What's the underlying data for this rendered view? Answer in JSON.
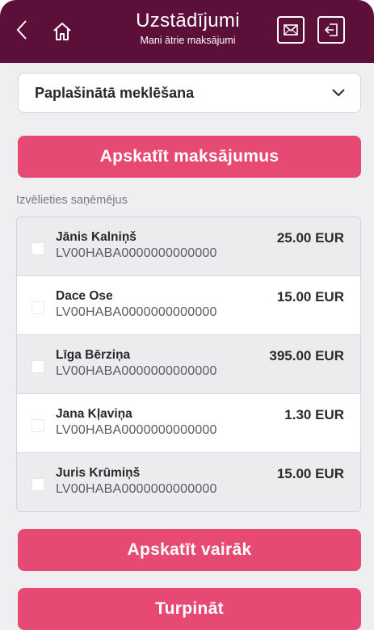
{
  "header": {
    "title": "Uzstādījumi",
    "subtitle": "Mani ātrie maksājumi",
    "back_icon": "chevron-left-icon",
    "home_icon": "home-icon",
    "mail_icon": "envelope-icon",
    "exit_icon": "logout-icon"
  },
  "search": {
    "dropdown_label": "Paplašinātā meklēšana"
  },
  "actions": {
    "view_payments_label": "Apskatīt maksājumus",
    "view_more_label": "Apskatīt vairāk",
    "continue_label": "Turpināt"
  },
  "recipients": {
    "section_label": "Izvēlieties saņēmējus",
    "items": [
      {
        "name": "Jānis Kalniņš",
        "iban": "LV00HABA0000000000000",
        "amount": "25.00 EUR"
      },
      {
        "name": "Dace Ose",
        "iban": "LV00HABA0000000000000",
        "amount": "15.00 EUR"
      },
      {
        "name": "Līga Bērziņa",
        "iban": "LV00HABA0000000000000",
        "amount": "395.00 EUR"
      },
      {
        "name": "Jana Kļaviņa",
        "iban": "LV00HABA0000000000000",
        "amount": "1.30 EUR"
      },
      {
        "name": "Juris Krūmiņš",
        "iban": "LV00HABA0000000000000",
        "amount": "15.00 EUR"
      }
    ]
  },
  "colors": {
    "header_bg": "#5b0f39",
    "accent": "#e64a72",
    "page_bg": "#efeff1"
  }
}
